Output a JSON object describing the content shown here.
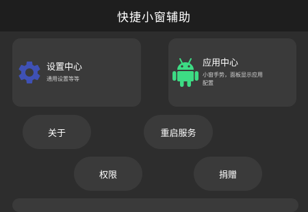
{
  "header": {
    "title": "快捷小窗辅助"
  },
  "cards": {
    "settings": {
      "title": "设置中心",
      "subtitle": "通用设置等等",
      "icon": "gear-icon",
      "icon_color": "#3f51b5"
    },
    "apps": {
      "title": "应用中心",
      "subtitle": "小窗手势，面板显示应用配置",
      "icon": "android-icon",
      "icon_color": "#3ddc84"
    }
  },
  "buttons": {
    "about": "关于",
    "restart_service": "重启服务",
    "permissions": "权限",
    "donate": "捐赠"
  },
  "colors": {
    "background": "#2d2d2d",
    "header_background": "#1e1e1e",
    "card_background": "#3a3a3a",
    "text": "#ffffff"
  }
}
